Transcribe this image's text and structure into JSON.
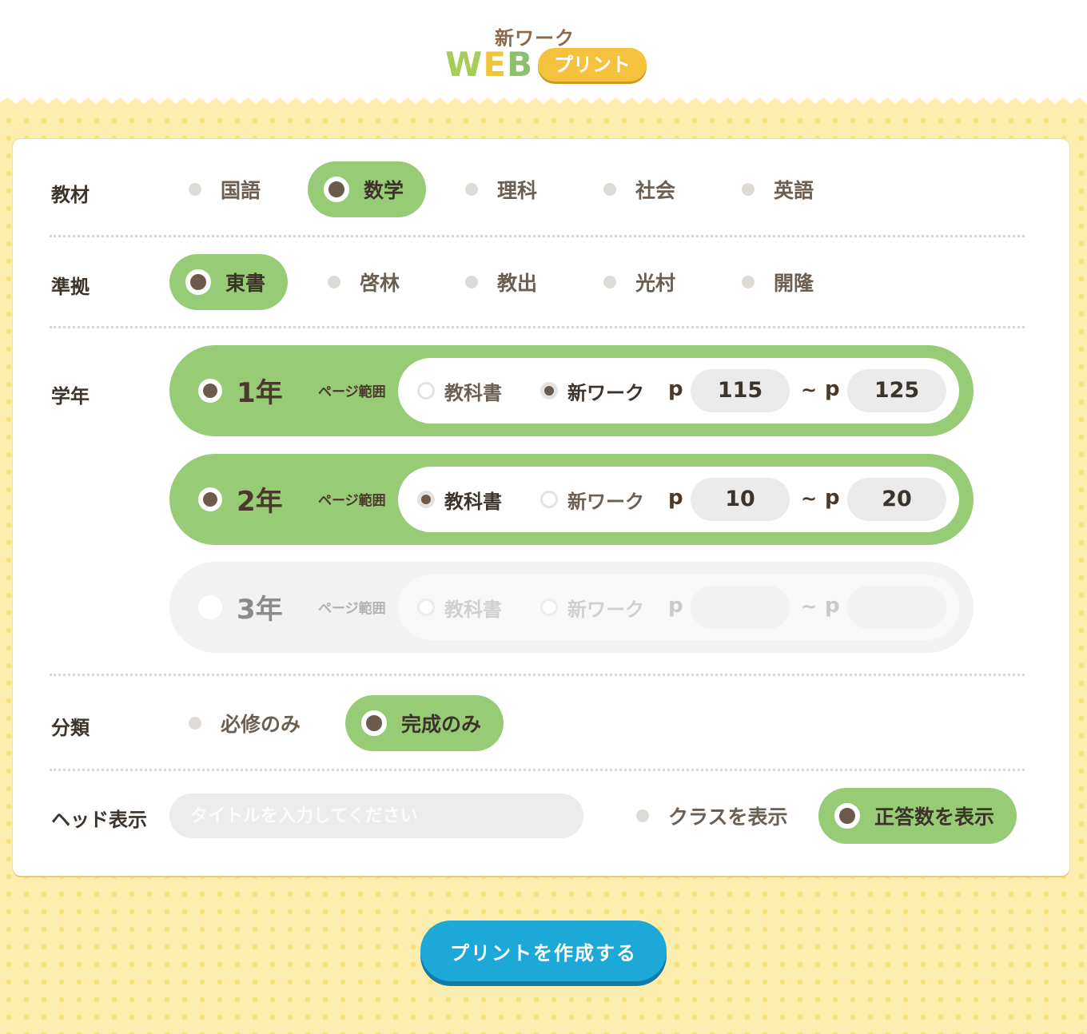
{
  "header": {
    "logo_sub": "新ワーク",
    "logo_web": [
      "W",
      "E",
      "B"
    ],
    "logo_badge": "プリント"
  },
  "colors": {
    "accent_green": "#97cb76",
    "selected_dot": "#6c5a4c",
    "button_blue": "#1da9d8",
    "background_yellow": "#fdeeb0",
    "logo_orange": "#f4c23c"
  },
  "subject": {
    "label": "教材",
    "options": [
      "国語",
      "数学",
      "理科",
      "社会",
      "英語"
    ],
    "selected": "数学"
  },
  "textbook": {
    "label": "準拠",
    "options": [
      "東書",
      "啓林",
      "教出",
      "光村",
      "開隆"
    ],
    "selected": "東書"
  },
  "grade": {
    "label": "学年",
    "rows": [
      {
        "name": "1年",
        "page_range_label": "ページ範囲",
        "src_textbook": "教科書",
        "src_work": "新ワーク",
        "source_selected": "新ワーク",
        "p_label": "p",
        "tilde": "~",
        "p_from": "115",
        "p_to": "125",
        "enabled": true
      },
      {
        "name": "2年",
        "page_range_label": "ページ範囲",
        "src_textbook": "教科書",
        "src_work": "新ワーク",
        "source_selected": "教科書",
        "p_label": "p",
        "tilde": "~",
        "p_from": "10",
        "p_to": "20",
        "enabled": true
      },
      {
        "name": "3年",
        "page_range_label": "ページ範囲",
        "src_textbook": "教科書",
        "src_work": "新ワーク",
        "source_selected": "",
        "p_label": "p",
        "tilde": "~",
        "p_from": "",
        "p_to": "",
        "enabled": false
      }
    ]
  },
  "category": {
    "label": "分類",
    "options": [
      "必修のみ",
      "完成のみ"
    ],
    "selected": "完成のみ"
  },
  "head_display": {
    "label": "ヘッド表示",
    "title_placeholder": "タイトルを入力してください",
    "show_class": "クラスを表示",
    "show_score": "正答数を表示",
    "selected": "正答数を表示"
  },
  "actions": {
    "create_label": "プリントを作成する"
  }
}
